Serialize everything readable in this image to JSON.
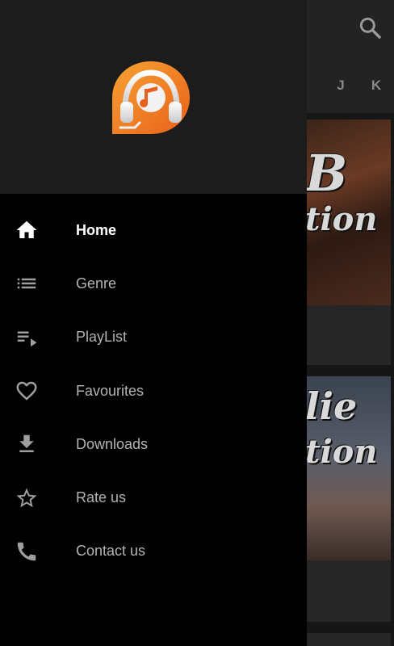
{
  "background": {
    "search_icon": "search-icon",
    "index_letters": [
      "J",
      "K"
    ],
    "cards": [
      {
        "line1": "B",
        "line2": "tion"
      },
      {
        "line1": "lie",
        "line2": "tion"
      }
    ]
  },
  "drawer": {
    "logo": "music-headphones-logo",
    "accent_color": "#f07a1a",
    "items": [
      {
        "label": "Home",
        "icon": "home-icon",
        "active": true
      },
      {
        "label": "Genre",
        "icon": "list-icon",
        "active": false
      },
      {
        "label": "PlayList",
        "icon": "playlist-icon",
        "active": false
      },
      {
        "label": "Favourites",
        "icon": "heart-icon",
        "active": false
      },
      {
        "label": "Downloads",
        "icon": "download-icon",
        "active": false
      },
      {
        "label": "Rate us",
        "icon": "star-icon",
        "active": false
      },
      {
        "label": "Contact us",
        "icon": "phone-icon",
        "active": false
      }
    ]
  }
}
